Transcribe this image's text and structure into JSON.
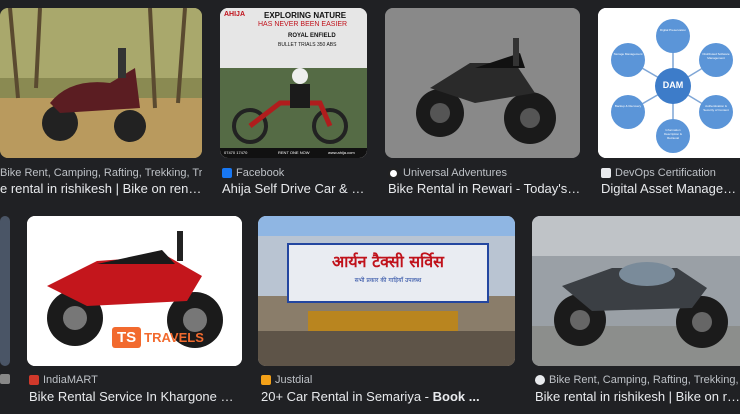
{
  "results": [
    {
      "source": "Bike Rent, Camping, Rafting, Trekking, Tr...",
      "title": "e rental in rishikesh | Bike on rent ..."
    },
    {
      "source": "Facebook",
      "title": "Ahija Self Drive Car & B..."
    },
    {
      "source": "Universal Adventures",
      "title": "Bike Rental in Rewari - Today's o..."
    },
    {
      "source": "DevOps Certification",
      "title": "Digital Asset Manageme..."
    },
    {
      "source": "IndiaMART",
      "title": "Bike Rental Service In Khargone Ma..."
    },
    {
      "source": "Justdial",
      "title_plain": "20+ Car Rental in Semariya - ",
      "title_bold": "Book ..."
    },
    {
      "source": "Bike Rent, Camping, Rafting, Trekking, T...",
      "title": "Bike rental in rishikesh | Bike on rent ..."
    }
  ],
  "ahija_ad": {
    "logo": "AHIJA",
    "headline1": "EXPLORING NATURE",
    "headline2": "HAS NEVER BEEN EASIER",
    "brand": "ROYAL ENFIELD",
    "model": "BULLET TRIALS 350 ABS",
    "phone": "07470 17470",
    "cta": "RENT ONE NOW",
    "site": "www.ahija.com"
  },
  "dam_diagram": {
    "center": "DAM",
    "nodes": [
      "Digital Preservation",
      "Distributed Software Management",
      "Authentication & Security of Content",
      "Information Description & Retrieval",
      "Backup & Recovery",
      "Storage Management"
    ]
  },
  "travel_logo": {
    "mark": "TS",
    "text": "TRAVELS"
  },
  "shop_sign": {
    "text": "आर्यन टैक्सी सर्विस",
    "sub": "सभी प्रकार की गाड़ियाँ उपलब्ध"
  },
  "colors": {
    "background": "#202124",
    "text": "#e8eaed",
    "muted": "#bdc1c6"
  },
  "icons": [
    "facebook-icon",
    "universal-adventures-icon",
    "devops-icon",
    "indiamart-icon",
    "justdial-icon",
    "bike-rent-icon"
  ]
}
